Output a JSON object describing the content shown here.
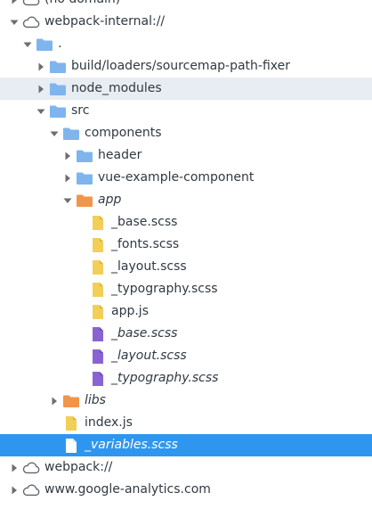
{
  "tree": {
    "no_domain": "(no domain)",
    "webpack_internal": "webpack-internal://",
    "dot_folder": ".",
    "build_folder": "build/loaders/sourcemap-path-fixer",
    "node_modules": "node_modules",
    "src": "src",
    "components": "components",
    "header": "header",
    "vue_example_component": "vue-example-component",
    "app_folder": "app",
    "base_scss": "_base.scss",
    "fonts_scss": "_fonts.scss",
    "layout_scss": "_layout.scss",
    "typography_scss": "_typography.scss",
    "app_js": "app.js",
    "base_scss_2": "_base.scss",
    "layout_scss_2": "_layout.scss",
    "typography_scss_2": "_typography.scss",
    "libs": "libs",
    "index_js": "index.js",
    "variables_scss": "_variables.scss",
    "webpack": "webpack://",
    "google_analytics": "www.google-analytics.com"
  },
  "colors": {
    "folder_blue": "#7fb5ee",
    "folder_orange": "#f0954b",
    "file_yellow": "#f2cf57",
    "file_purple": "#8a63d2",
    "selected_bg": "#2f96ef",
    "hover_bg": "#e8ecf3"
  }
}
